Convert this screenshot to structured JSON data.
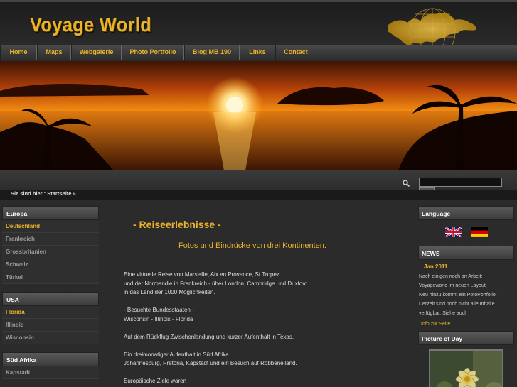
{
  "header": {
    "logo_text": "Voyage World"
  },
  "nav": [
    "Home",
    "Maps",
    "Webgalerie",
    "Photo Portfolio",
    "Blog MB 190",
    "Links",
    "Contact"
  ],
  "breadcrumb": "Sie sind hier : Startseite »",
  "sidebar": {
    "groups": [
      {
        "title": "Europa",
        "items": [
          "Deutschland",
          "Frankreich",
          "Grossbritanien",
          "Schweiz",
          "Türkei"
        ],
        "active": 0
      },
      {
        "title": "USA",
        "items": [
          "Florida",
          "Illinois",
          "Wisconsin"
        ],
        "active": 0
      },
      {
        "title": "Süd Afrika",
        "items": [
          "Kapstadt"
        ],
        "active": -1
      }
    ]
  },
  "main": {
    "title": "- Reiseerlebnisse -",
    "subtitle": "Fotos und Eindrücke von drei Kontinenten.",
    "paragraphs": [
      [
        "Eine virtuelle Reise von Marseille, Aix en Provence, St.Tropez",
        "und der Normandie in Frankreich - über London, Cambridge und Duxford",
        "in das Land der 1000 Möglichkeiten."
      ],
      [
        "- Besuchte Bundesstaaten -",
        "Wisconsin - Illinois - Florida"
      ],
      [
        "Auf dem Rückflug Zwischenlandung und kurzer Aufenthalt in Texas."
      ],
      [
        "Ein dreimonatiger Aufenthalt in Süd Afrika.",
        "Johannesburg, Pretoria, Kapstadt und ein Besuch auf Robbeneiland."
      ],
      [
        "Europäische Ziele waren"
      ]
    ]
  },
  "right": {
    "language_title": "Language",
    "news_title": "NEWS",
    "news_date": "Jan 2011",
    "news_lines": [
      "Nach einigen noch an Arbeit:",
      "Voyageworld im neuen Layout.",
      "Neu hinzu kommt ein PotoPortfolio.",
      "Derzeit sind noch nicht alle Inhalte",
      "verfügbar. Siehe auch"
    ],
    "news_link": "Info zur Seite.",
    "potd_title": "Picture of Day"
  },
  "colors": {
    "accent": "#e9b32a",
    "background": "#2b2b2b"
  }
}
